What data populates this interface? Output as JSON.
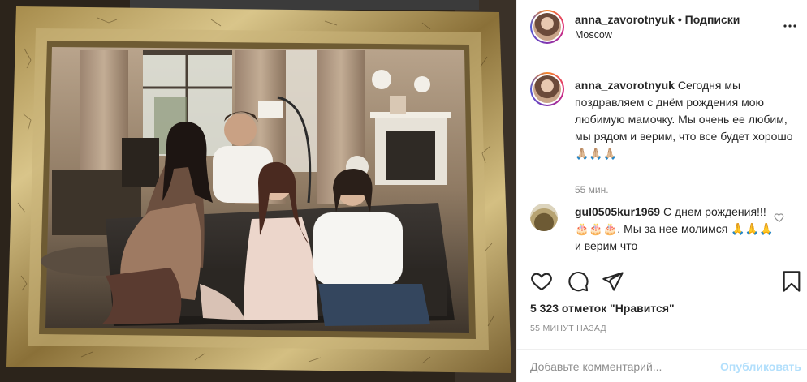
{
  "post": {
    "username": "anna_zavorotnyuk",
    "separator": "•",
    "follow_label": "Подписки",
    "location": "Moscow",
    "more_icon": "more-horizontal-icon"
  },
  "caption": {
    "username": "anna_zavorotnyuk",
    "text": "Сегодня мы поздравляем с днём рождения мою любимую мамочку. Мы очень ее любим, мы рядом и верим, что все будет хорошо🙏🏼🙏🏼🙏🏼",
    "time": "55 мин."
  },
  "comment": {
    "username": "gul0505kur1969",
    "text": "С днем рождения!!!🎂🎂🎂. Мы за нее молимся 🙏🙏🙏и верим что"
  },
  "actions": {
    "like_icon": "heart-icon",
    "comment_icon": "comment-icon",
    "share_icon": "share-icon",
    "save_icon": "bookmark-icon"
  },
  "likes": "5 323 отметок \"Нравится\"",
  "post_time": "55 МИНУТ НАЗАД",
  "add_comment": {
    "placeholder": "Добавьте комментарий...",
    "publish_label": "Опубликовать"
  },
  "colors": {
    "accent": "#0095f6",
    "publish_disabled": "#b2dffc",
    "muted": "#8e8e8e",
    "border": "#efefef"
  }
}
